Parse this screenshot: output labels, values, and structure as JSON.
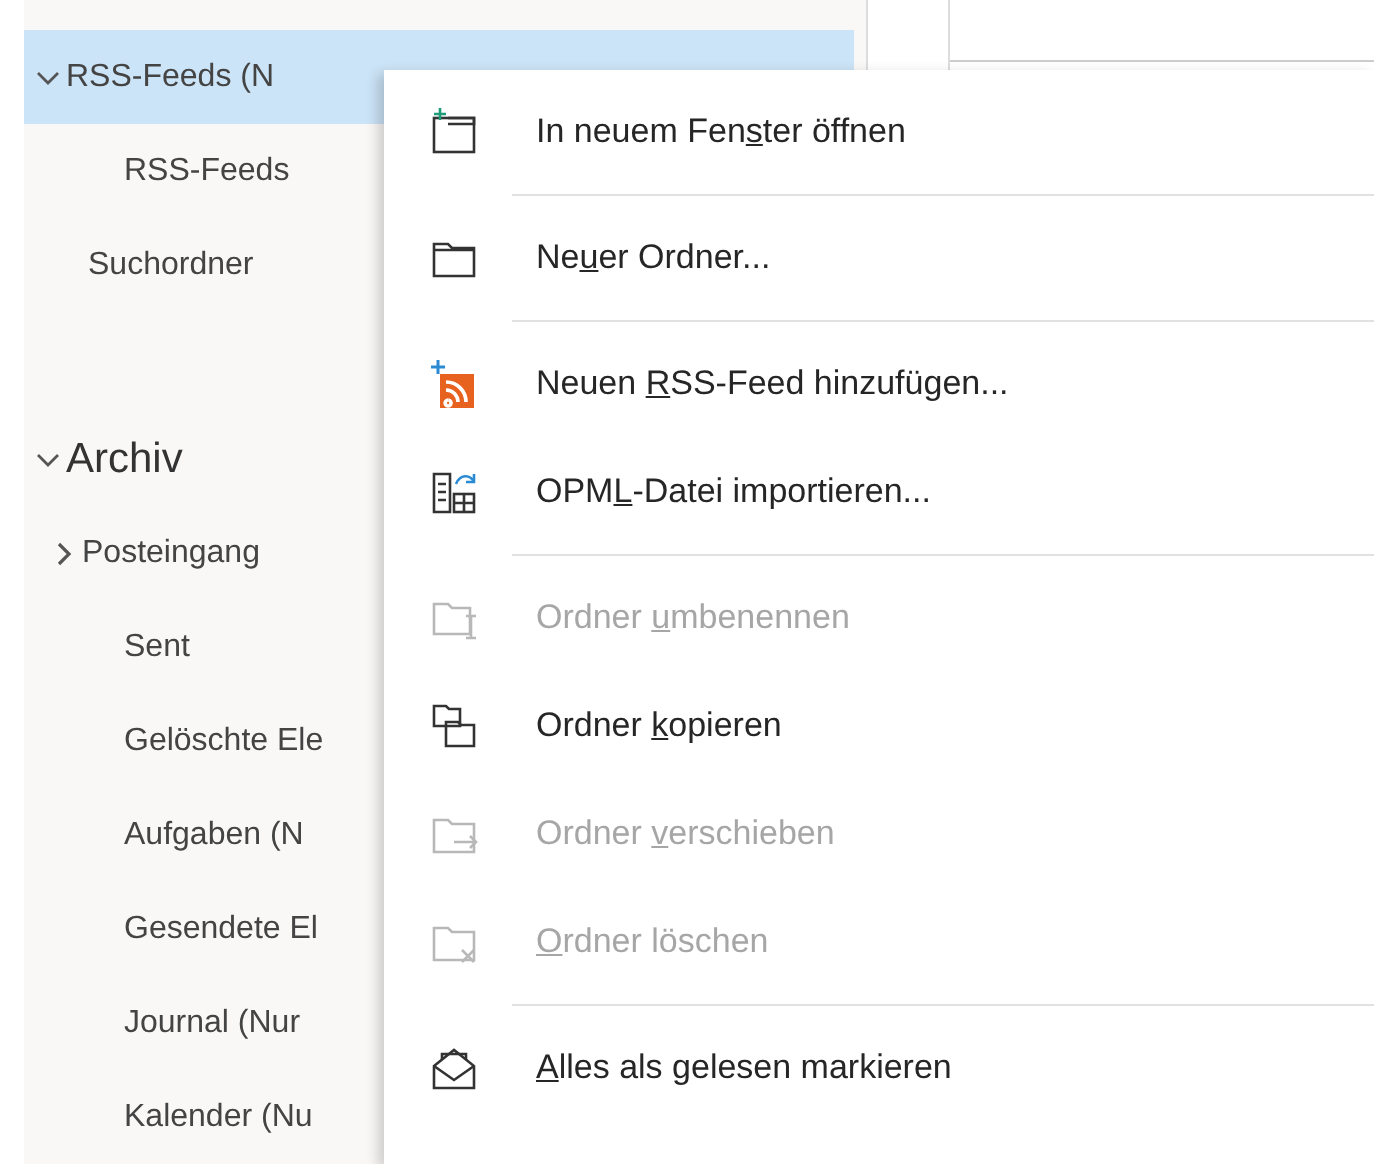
{
  "sidebar": {
    "items": [
      {
        "label": "RSS-Feeds (N",
        "kind": "folder",
        "expanded": true,
        "selected": true,
        "children": [
          {
            "label": "RSS-Feeds",
            "kind": "folder",
            "selected": false
          }
        ]
      },
      {
        "label": "Suchordner",
        "kind": "folder",
        "selected": false
      },
      {
        "label": "Archiv",
        "kind": "account",
        "expanded": true,
        "selected": false,
        "children": [
          {
            "label": "Posteingang",
            "kind": "folder",
            "expanded": false,
            "selected": false
          },
          {
            "label": "Sent",
            "kind": "folder",
            "selected": false
          },
          {
            "label": "Gelöschte Ele",
            "kind": "folder",
            "selected": false
          },
          {
            "label": "Aufgaben (N",
            "kind": "folder",
            "selected": false
          },
          {
            "label": "Gesendete El",
            "kind": "folder",
            "selected": false
          },
          {
            "label": "Journal (Nur",
            "kind": "folder",
            "selected": false
          },
          {
            "label": "Kalender (Nu",
            "kind": "folder",
            "selected": false
          }
        ]
      }
    ]
  },
  "context_menu": {
    "items": [
      {
        "kind": "window",
        "before": "In neuem Fen",
        "access_key": "s",
        "after": "ter öffnen",
        "disabled": false,
        "separator_after": true
      },
      {
        "kind": "folder",
        "before": "Ne",
        "access_key": "u",
        "after": "er Ordner...",
        "disabled": false,
        "separator_after": true
      },
      {
        "kind": "rss",
        "before": "Neuen ",
        "access_key": "R",
        "after": "SS-Feed hinzufügen...",
        "disabled": false,
        "separator_after": false
      },
      {
        "kind": "import",
        "before": "OPM",
        "access_key": "L",
        "after": "-Datei importieren...",
        "disabled": false,
        "separator_after": true
      },
      {
        "kind": "rename",
        "before": "Ordner ",
        "access_key": "u",
        "after": "mbenennen",
        "disabled": true,
        "separator_after": false
      },
      {
        "kind": "copy",
        "before": "Ordner ",
        "access_key": "k",
        "after": "opieren",
        "disabled": false,
        "separator_after": false
      },
      {
        "kind": "move",
        "before": "Ordner ",
        "access_key": "v",
        "after": "erschieben",
        "disabled": true,
        "separator_after": false
      },
      {
        "kind": "delete",
        "access_key": "O",
        "after": "rdner löschen",
        "disabled": true,
        "separator_after": true
      },
      {
        "kind": "read",
        "access_key": "A",
        "after": "lles als gelesen markieren",
        "disabled": false,
        "separator_after": false
      }
    ]
  }
}
